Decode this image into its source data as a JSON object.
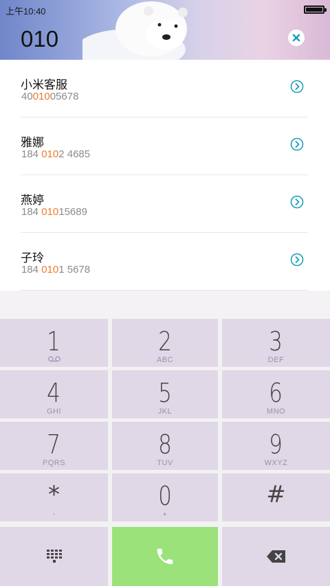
{
  "status_bar": {
    "time": "上午10:40"
  },
  "dialer": {
    "input_value": "010"
  },
  "results": [
    {
      "name": "小米客服",
      "pre": "40",
      "match": "010",
      "post": "05678"
    },
    {
      "name": "雅娜",
      "pre": "184 ",
      "match": "010",
      "post": "2 4685"
    },
    {
      "name": "燕婷",
      "pre": "184 ",
      "match": "010",
      "post": "15689"
    },
    {
      "name": "子玲",
      "pre": "184 ",
      "match": "010",
      "post": "1 5678"
    }
  ],
  "keypad": {
    "keys": [
      {
        "digit": "1",
        "letters": ""
      },
      {
        "digit": "2",
        "letters": "ABC"
      },
      {
        "digit": "3",
        "letters": "DEF"
      },
      {
        "digit": "4",
        "letters": "GHI"
      },
      {
        "digit": "5",
        "letters": "JKL"
      },
      {
        "digit": "6",
        "letters": "MNO"
      },
      {
        "digit": "7",
        "letters": "PQRS"
      },
      {
        "digit": "8",
        "letters": "TUV"
      },
      {
        "digit": "9",
        "letters": "WXYZ"
      },
      {
        "digit": "*",
        "letters": ","
      },
      {
        "digit": "0",
        "letters": "+"
      },
      {
        "digit": "#",
        "letters": ""
      }
    ]
  },
  "colors": {
    "highlight": "#f07a2b",
    "accent": "#1aa0b8",
    "call_button": "#9be27a",
    "key_background": "#e0d8e7"
  },
  "icons": {
    "clear": "close-circle-icon",
    "detail": "chevron-circle-right-icon",
    "voicemail": "voicemail-icon",
    "keypad_toggle": "dialpad-grid-icon",
    "call": "phone-icon",
    "backspace": "backspace-icon"
  }
}
